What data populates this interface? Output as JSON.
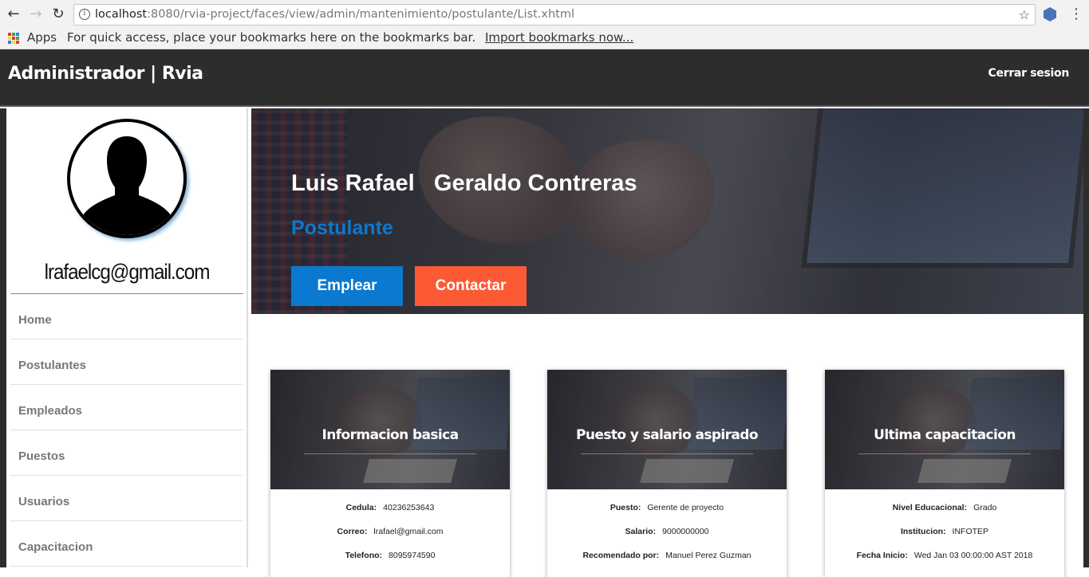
{
  "browser": {
    "url_host": "localhost",
    "url_rest": ":8080/rvia-project/faces/view/admin/mantenimiento/postulante/List.xhtml",
    "bookmarks": {
      "apps_label": "Apps",
      "hint": "For quick access, place your bookmarks here on the bookmarks bar.",
      "import_link": "Import bookmarks now..."
    }
  },
  "header": {
    "title": "Administrador | Rvia",
    "logout_label": "Cerrar sesion"
  },
  "sidebar": {
    "email": "lrafaelcg@gmail.com",
    "items": [
      {
        "label": "Home"
      },
      {
        "label": "Postulantes"
      },
      {
        "label": "Empleados"
      },
      {
        "label": "Puestos"
      },
      {
        "label": "Usuarios"
      },
      {
        "label": "Capacitacion"
      }
    ]
  },
  "hero": {
    "name": "Luis Rafael   Geraldo Contreras",
    "role": "Postulante",
    "hire_label": "Emplear",
    "contact_label": "Contactar"
  },
  "cards": [
    {
      "title": "Informacion basica",
      "rows": [
        {
          "key": "Cedula:",
          "value": "40236253643"
        },
        {
          "key": "Correo:",
          "value": "lrafael@gmail.com"
        },
        {
          "key": "Telefono:",
          "value": "8095974590"
        }
      ]
    },
    {
      "title": "Puesto y salario aspirado",
      "rows": [
        {
          "key": "Puesto:",
          "value": "Gerente de proyecto"
        },
        {
          "key": "Salario:",
          "value": "9000000000"
        },
        {
          "key": "Recomendado por:",
          "value": "Manuel Perez Guzman"
        }
      ]
    },
    {
      "title": "Ultima capacitacion",
      "rows": [
        {
          "key": "Nivel Educacional:",
          "value": "Grado"
        },
        {
          "key": "Institucion:",
          "value": "INFOTEP"
        },
        {
          "key": "Fecha Inicio:",
          "value": "Wed Jan 03 00:00:00 AST 2018"
        }
      ]
    }
  ],
  "colors": {
    "header_bg": "#2d2d2d",
    "primary": "#0b79d0",
    "accent": "#fc5a35"
  }
}
